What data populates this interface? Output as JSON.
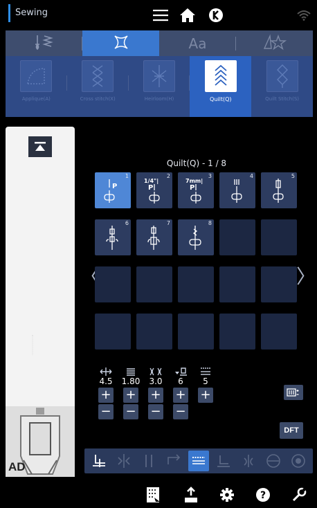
{
  "topbar": {
    "mode_label": "Sewing",
    "icons": [
      "menu-icon",
      "home-icon",
      "brand-logo-icon",
      "wifi-icon"
    ]
  },
  "categories": [
    {
      "icon": "utility-stitch-icon",
      "active": false
    },
    {
      "icon": "decorative-stitch-icon",
      "active": true
    },
    {
      "icon": "font-icon",
      "label": "Aa",
      "active": false
    },
    {
      "icon": "favorites-icon",
      "active": false
    }
  ],
  "subcategories": [
    {
      "label": "Applique(A)",
      "active": false
    },
    {
      "label": "Cross stitch(X)",
      "active": false
    },
    {
      "label": "Heirloom(H)",
      "active": false
    },
    {
      "label": "Quilt(Q)",
      "active": true
    },
    {
      "label": "Quilt Stitch(S)",
      "active": false
    }
  ],
  "grid": {
    "title": "Quilt(Q) - 1 / 8",
    "cells": [
      {
        "num": "1",
        "label": "P",
        "selected": true
      },
      {
        "num": "2",
        "label": "1/4\"| P",
        "selected": false
      },
      {
        "num": "3",
        "label": "7mm| P",
        "selected": false
      },
      {
        "num": "4",
        "label": "",
        "selected": false
      },
      {
        "num": "5",
        "label": "",
        "selected": false
      },
      {
        "num": "6",
        "label": "",
        "selected": false
      },
      {
        "num": "7",
        "label": "",
        "selected": false
      },
      {
        "num": "8",
        "label": "",
        "selected": false
      }
    ]
  },
  "params": [
    {
      "icon": "stitch-width-icon",
      "value": "4.5"
    },
    {
      "icon": "stitch-length-icon",
      "value": "1.80"
    },
    {
      "icon": "tension-icon",
      "value": "3.0"
    },
    {
      "icon": "presser-foot-pressure-icon",
      "value": "6"
    },
    {
      "icon": "feed-dog-icon",
      "value": "5"
    }
  ],
  "buttons": {
    "plus": "+",
    "minus": "−",
    "dft": "DFT"
  },
  "leftpanel": {
    "foot_label": "AD"
  },
  "colors": {
    "accent": "#3a78cf",
    "panel": "#2f4a86",
    "cell": "#1c2742"
  }
}
